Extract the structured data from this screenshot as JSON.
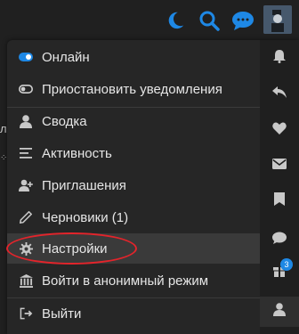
{
  "header": {
    "icons": [
      "moon-icon",
      "search-icon",
      "chat-icon"
    ],
    "accent": "#1e88e5"
  },
  "background": {
    "fragment_1": "л"
  },
  "menu": {
    "items": [
      {
        "label": "Онлайн",
        "icon": "toggle-on-icon"
      },
      {
        "label": "Приостановить уведомления",
        "icon": "toggle-off-icon"
      },
      {
        "label": "Сводка",
        "icon": "user-icon"
      },
      {
        "label": "Активность",
        "icon": "list-icon"
      },
      {
        "label": "Приглашения",
        "icon": "user-plus-icon"
      },
      {
        "label": "Черновики (1)",
        "icon": "pencil-icon"
      },
      {
        "label": "Настройки",
        "icon": "gear-icon"
      },
      {
        "label": "Войти в анонимный режим",
        "icon": "building-icon"
      },
      {
        "label": "Выйти",
        "icon": "logout-icon"
      }
    ]
  },
  "rail": {
    "icons": [
      "bell-icon",
      "reply-icon",
      "heart-icon",
      "envelope-icon",
      "bookmark-icon",
      "chat-bubble-icon",
      "gift-icon",
      "user-icon"
    ],
    "badge": "3"
  },
  "colors": {
    "highlight_ring": "#e3242b",
    "toggle_on": "#1e88e5"
  }
}
